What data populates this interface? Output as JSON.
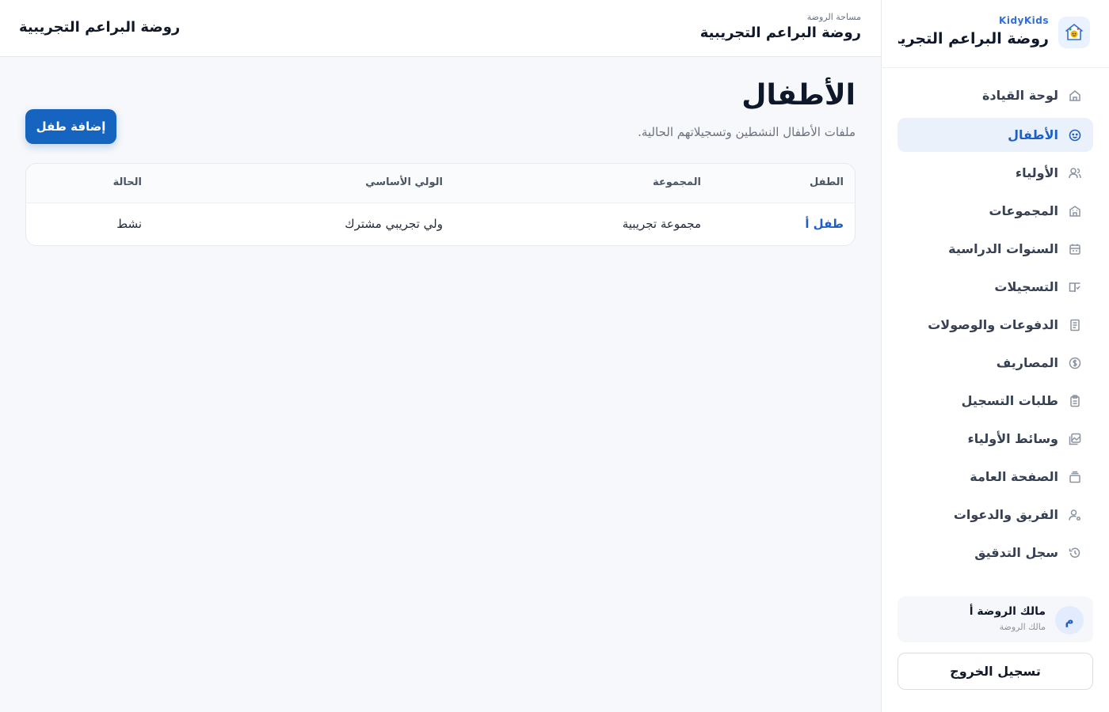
{
  "brand": {
    "app_name": "KidyKids",
    "kindergarten_name": "روضة البراعم التجريب..."
  },
  "sidebar": {
    "items": [
      {
        "label": "لوحة القيادة",
        "icon": "home-icon",
        "active": false
      },
      {
        "label": "الأطفال",
        "icon": "child-face-icon",
        "active": true
      },
      {
        "label": "الأولياء",
        "icon": "users-icon",
        "active": false
      },
      {
        "label": "المجموعات",
        "icon": "building-icon",
        "active": false
      },
      {
        "label": "السنوات الدراسية",
        "icon": "calendar-icon",
        "active": false
      },
      {
        "label": "التسجيلات",
        "icon": "book-check-icon",
        "active": false
      },
      {
        "label": "الدفوعات والوصولات",
        "icon": "receipt-icon",
        "active": false
      },
      {
        "label": "المصاريف",
        "icon": "dollar-circle-icon",
        "active": false
      },
      {
        "label": "طلبات التسجيل",
        "icon": "clipboard-icon",
        "active": false
      },
      {
        "label": "وسائط الأولياء",
        "icon": "images-icon",
        "active": false
      },
      {
        "label": "الصفحة العامة",
        "icon": "layers-icon",
        "active": false
      },
      {
        "label": "الفريق والدعوات",
        "icon": "user-gear-icon",
        "active": false
      },
      {
        "label": "سجل التدقيق",
        "icon": "history-icon",
        "active": false
      }
    ]
  },
  "user": {
    "avatar_letter": "م",
    "name": "مالك الروضة أ",
    "role": "مالك الروضة"
  },
  "logout_label": "تسجيل الخروج",
  "header": {
    "workspace_label": "مساحة الروضة",
    "workspace_name": "روضة البراعم التجريبية",
    "left_title": "روضة البراعم التجريبية"
  },
  "page": {
    "title": "الأطفال",
    "subtitle": "ملفات الأطفال النشطين وتسجيلاتهم الحالية.",
    "add_button": "إضافة طفل"
  },
  "table": {
    "columns": [
      "الطفل",
      "المجموعة",
      "الولي الأساسي",
      "الحالة"
    ],
    "rows": [
      [
        "طفل أ",
        "مجموعة تجريبية",
        "ولي تجريبي مشترك",
        "نشط"
      ]
    ]
  },
  "colors": {
    "accent": "#1565c0",
    "active_nav_bg": "#eaf1fb",
    "link": "#1f5fc4"
  }
}
